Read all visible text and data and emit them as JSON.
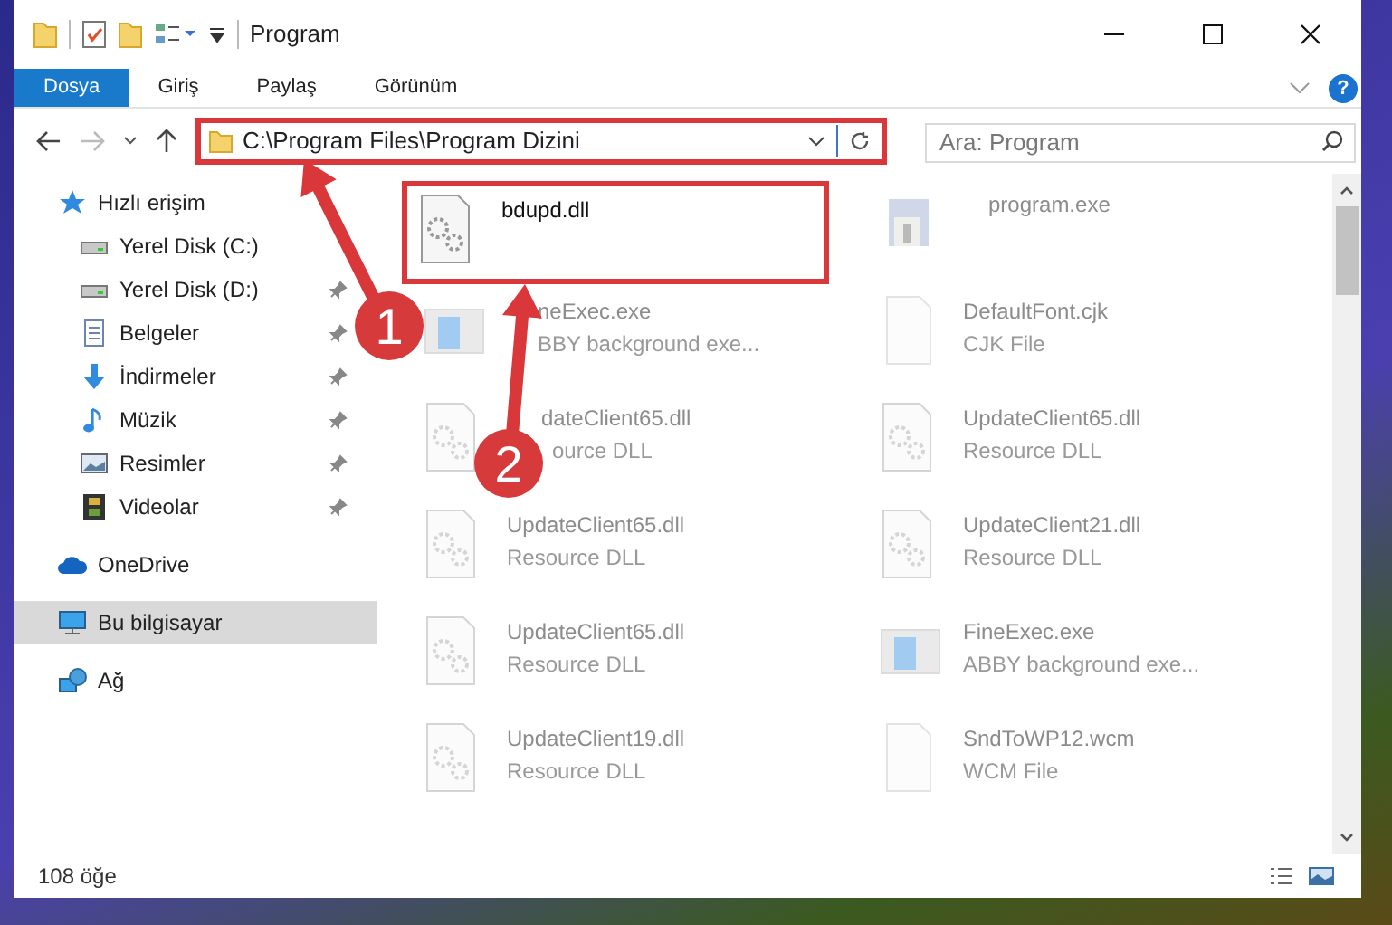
{
  "window": {
    "title": "Program"
  },
  "ribbon_tabs": [
    {
      "label": "Dosya",
      "selected": true
    },
    {
      "label": "Giriş",
      "selected": false
    },
    {
      "label": "Paylaş",
      "selected": false
    },
    {
      "label": "Görünüm",
      "selected": false
    }
  ],
  "help_button": {
    "label": "?"
  },
  "address_bar": {
    "path": "C:\\Program Files\\Program Dizini",
    "highlighted": true
  },
  "search": {
    "placeholder": "Ara: Program"
  },
  "sidebar": {
    "items": [
      {
        "label": "Hızlı erişim",
        "selected": false,
        "children": [
          {
            "label": "Yerel Disk (C:)",
            "pinned": false,
            "selected": false
          },
          {
            "label": "Yerel Disk (D:)",
            "pinned": true,
            "selected": false
          },
          {
            "label": "Belgeler",
            "pinned": true,
            "selected": false
          },
          {
            "label": "İndirmeler",
            "pinned": true,
            "selected": false
          },
          {
            "label": "Müzik",
            "pinned": true,
            "selected": false
          },
          {
            "label": "Resimler",
            "pinned": true,
            "selected": false
          },
          {
            "label": "Videolar",
            "pinned": true,
            "selected": false
          }
        ]
      },
      {
        "label": "OneDrive",
        "selected": false
      },
      {
        "label": "Bu bilgisayar",
        "selected": true
      },
      {
        "label": "Ağ",
        "selected": false
      }
    ]
  },
  "files": [
    {
      "name": "bdupd.dll",
      "kind": "dll",
      "faded": false,
      "highlighted": true
    },
    {
      "name": "program.exe",
      "kind": "exe",
      "faded": true,
      "highlighted": false
    },
    {
      "name": "neExec.exe",
      "type": "BBY background exe...",
      "kind": "window",
      "faded": true,
      "highlighted": false
    },
    {
      "name": "DefaultFont.cjk",
      "type": "CJK File",
      "kind": "blank",
      "faded": true,
      "highlighted": false
    },
    {
      "name": "dateClient65.dll",
      "type": "ource DLL",
      "kind": "dll",
      "faded": true,
      "highlighted": false
    },
    {
      "name": "UpdateClient65.dll",
      "type": "Resource DLL",
      "kind": "dll",
      "faded": true,
      "highlighted": false
    },
    {
      "name": "UpdateClient65.dll",
      "type": "Resource DLL",
      "kind": "dll",
      "faded": true,
      "highlighted": false
    },
    {
      "name": "UpdateClient21.dll",
      "type": "Resource DLL",
      "kind": "dll",
      "faded": true,
      "highlighted": false
    },
    {
      "name": "UpdateClient65.dll",
      "type": "Resource DLL",
      "kind": "dll",
      "faded": true,
      "highlighted": false
    },
    {
      "name": "FineExec.exe",
      "type": "ABBY background exe...",
      "kind": "window",
      "faded": true,
      "highlighted": false
    },
    {
      "name": "UpdateClient19.dll",
      "type": "Resource DLL",
      "kind": "dll",
      "faded": true,
      "highlighted": false
    },
    {
      "name": "SndToWP12.wcm",
      "type": "WCM File",
      "kind": "blank",
      "faded": true,
      "highlighted": false
    }
  ],
  "annotations": [
    {
      "label": "1"
    },
    {
      "label": "2"
    }
  ],
  "status_bar": {
    "item_count": "108 öğe"
  }
}
